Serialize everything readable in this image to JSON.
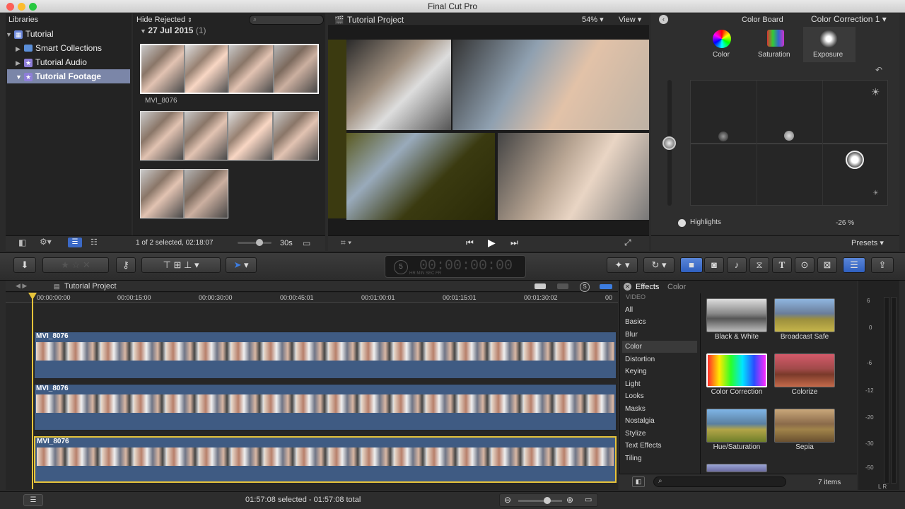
{
  "window": {
    "title": "Final Cut Pro"
  },
  "libraries": {
    "header": "Libraries",
    "items": [
      {
        "label": "Tutorial",
        "icon": "library-icon"
      },
      {
        "label": "Smart Collections",
        "icon": "folder-icon"
      },
      {
        "label": "Tutorial Audio",
        "icon": "event-icon"
      },
      {
        "label": "Tutorial Footage",
        "icon": "event-icon"
      }
    ]
  },
  "browser": {
    "filter": "Hide Rejected",
    "date": "27 Jul 2015",
    "count": "(1)",
    "clip_name": "MVI_8076",
    "status": "1 of 2 selected, 02:18:07",
    "zoom": "30s"
  },
  "viewer": {
    "title": "Tutorial Project",
    "zoom": "54%",
    "view": "View"
  },
  "inspector": {
    "title": "Color Board",
    "correction": "Color Correction 1",
    "tabs": [
      "Color",
      "Saturation",
      "Exposure"
    ],
    "highlights_label": "Highlights",
    "highlights_value": "-26 %",
    "presets": "Presets"
  },
  "timecode": {
    "value": "00:00:00:00",
    "hr": "HR",
    "min": "MIN",
    "sec": "SEC",
    "fr": "FR",
    "rate": "5"
  },
  "timeline": {
    "title": "Tutorial Project",
    "ticks": [
      "00:00:00:00",
      "00:00:15:00",
      "00:00:30:00",
      "00:00:45:01",
      "00:01:00:01",
      "00:01:15:01",
      "00:01:30:02",
      "00"
    ],
    "clips": [
      "MVI_8076",
      "MVI_8076",
      "MVI_8076"
    ],
    "status": "01:57:08 selected - 01:57:08 total"
  },
  "effects": {
    "tab_effects": "Effects",
    "tab_color": "Color",
    "section": "VIDEO",
    "categories": [
      "All",
      "Basics",
      "Blur",
      "Color",
      "Distortion",
      "Keying",
      "Light",
      "Looks",
      "Masks",
      "Nostalgia",
      "Stylize",
      "Text Effects",
      "Tiling"
    ],
    "selected": "Color",
    "items": [
      "Black & White",
      "Broadcast Safe",
      "Color Correction",
      "Colorize",
      "Hue/Saturation",
      "Sepia"
    ],
    "count": "7 items"
  },
  "meter": {
    "scale": [
      "6",
      "0",
      "-6",
      "-12",
      "-20",
      "-30",
      "-50"
    ],
    "channels": [
      "L",
      "R"
    ]
  }
}
